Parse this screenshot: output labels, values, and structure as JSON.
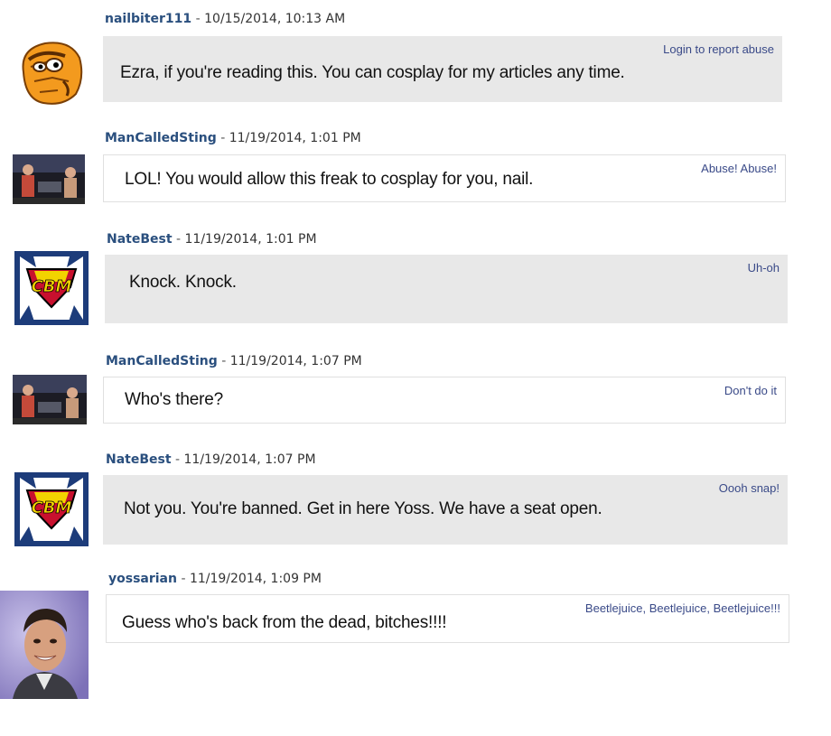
{
  "comments": [
    {
      "username": "nailbiter111",
      "timestamp": "10/15/2014, 10:13 AM",
      "action": "Login to report abuse",
      "text": "Ezra, if you're reading this. You can cosplay for my articles any time.",
      "avatar": "thing-cartoon-avatar"
    },
    {
      "username": "ManCalledSting",
      "timestamp": "11/19/2014, 1:01 PM",
      "action": "Abuse! Abuse!",
      "text": "LOL! You would allow this freak to cosplay for you, nail.",
      "avatar": "band-photo-avatar"
    },
    {
      "username": "NateBest",
      "timestamp": "11/19/2014, 1:01 PM",
      "action": "Uh-oh",
      "text": "Knock. Knock.",
      "avatar": "cbm-logo-avatar"
    },
    {
      "username": "ManCalledSting",
      "timestamp": "11/19/2014, 1:07 PM",
      "action": "Don't do it",
      "text": "Who's there?",
      "avatar": "band-photo-avatar"
    },
    {
      "username": "NateBest",
      "timestamp": "11/19/2014, 1:07 PM",
      "action": "Oooh snap!",
      "text": "Not you. You're banned. Get in here Yoss.  We have a seat open.",
      "avatar": "cbm-logo-avatar"
    },
    {
      "username": "yossarian",
      "timestamp": "11/19/2014, 1:09 PM",
      "action": "Beetlejuice, Beetlejuice, Beetlejuice!!!",
      "text": "Guess who's back from the dead, bitches!!!!",
      "avatar": "man-portrait-avatar"
    }
  ],
  "separator": "-",
  "logo_text": "CBM",
  "colors": {
    "username": "#2a4f7e",
    "action_link": "#3a4a88",
    "bubble_grey": "#e8e8e8"
  }
}
